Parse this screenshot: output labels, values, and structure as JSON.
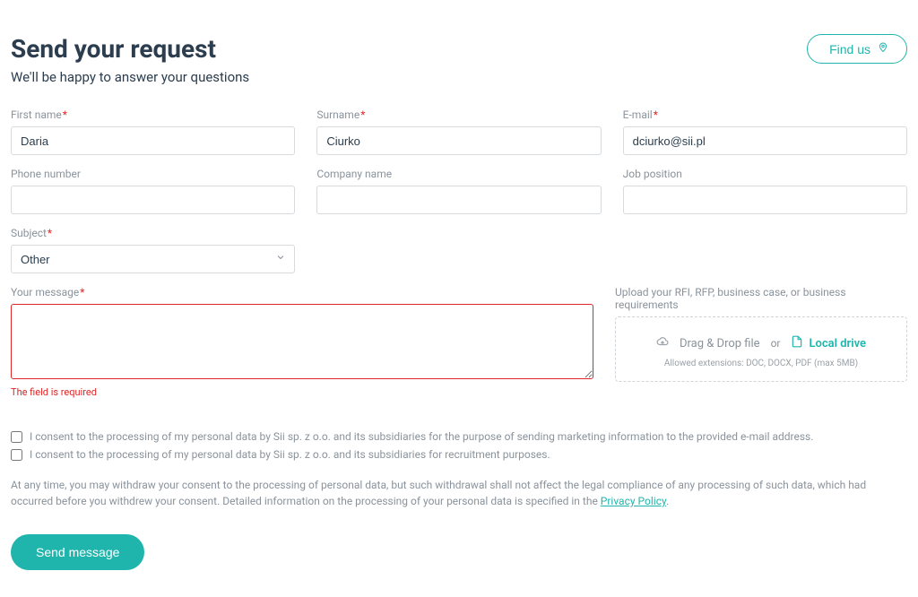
{
  "header": {
    "title": "Send your request",
    "subtitle": "We'll be happy to answer your questions",
    "find_us": "Find us"
  },
  "labels": {
    "first_name": "First name",
    "surname": "Surname",
    "email": "E-mail",
    "phone": "Phone number",
    "company": "Company name",
    "job": "Job position",
    "subject": "Subject",
    "message": "Your message",
    "upload": "Upload your RFI, RFP, business case, or business requirements"
  },
  "values": {
    "first_name": "Daria",
    "surname": "Ciurko",
    "email": "dciurko@sii.pl",
    "phone": "",
    "company": "",
    "job": "",
    "subject": "Other",
    "message": ""
  },
  "errors": {
    "message": "The field is required"
  },
  "upload": {
    "drag": "Drag & Drop file",
    "or": "or",
    "local": "Local drive",
    "allowed": "Allowed extensions: DOC, DOCX, PDF (max 5MB)"
  },
  "consents": {
    "marketing": "I consent to the processing of my personal data by Sii sp. z o.o. and its subsidiaries for the purpose of sending marketing information to the provided e-mail address.",
    "recruitment": "I consent to the processing of my personal data by Sii sp. z o.o. and its subsidiaries for recruitment purposes."
  },
  "disclaimer": {
    "text_before": "At any time, you may withdraw your consent to the processing of personal data, but such withdrawal shall not affect the legal compliance of any processing of such data, which had occurred before you withdrew your consent. Detailed information on the processing of your personal data is specified in the ",
    "link": "Privacy Policy",
    "text_after": "."
  },
  "submit": "Send message"
}
